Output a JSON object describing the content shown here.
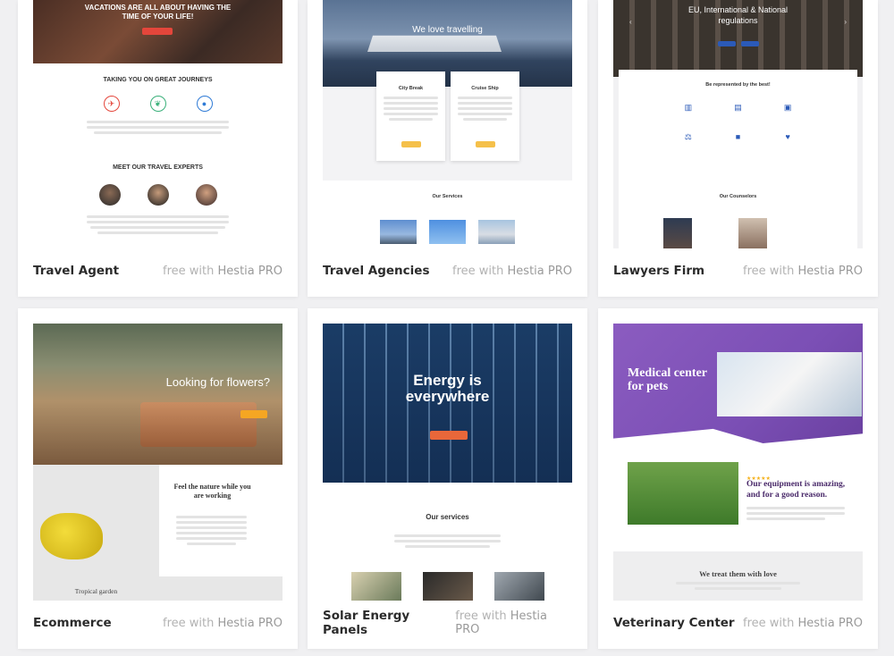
{
  "footer_badge": {
    "prefix": "free with",
    "brand": "Hestia PRO"
  },
  "cards": [
    {
      "title": "Travel Agent",
      "hero_title": "VACATIONS ARE ALL ABOUT HAVING THE TIME OF YOUR LIFE!",
      "section1_title": "TAKING YOU ON GREAT JOURNEYS",
      "section2_title": "MEET OUR TRAVEL EXPERTS"
    },
    {
      "title": "Travel Agencies",
      "hero_title": "We love travelling",
      "box1_title": "City Break",
      "box2_title": "Cruise Ship",
      "services_title": "Our Services"
    },
    {
      "title": "Lawyers Firm",
      "hero_title": "EU, International & National regulations",
      "section_title": "Be represented by the best!",
      "counselors_title": "Our Counselors"
    },
    {
      "title": "Ecommerce",
      "hero_title": "Looking for flowers?",
      "feature_title": "Feel the nature while you are working",
      "caption": "Tropical garden"
    },
    {
      "title": "Solar Energy Panels",
      "hero_title": "Energy is everywhere",
      "services_title": "Our services"
    },
    {
      "title": "Veterinary Center",
      "hero_title": "Medical center for pets",
      "feature_title": "Our equipment is amazing, and for a good reason.",
      "bottom_title": "We treat them with love"
    }
  ],
  "colors": {
    "page_bg": "#f0f0f2",
    "card_bg": "#ffffff",
    "travel_accent": "#e4463b",
    "lawyer_blue": "#2b5ab8",
    "eco_orange": "#f5a623",
    "solar_button": "#e8673a",
    "vet_purple": "#7b4fb5"
  }
}
